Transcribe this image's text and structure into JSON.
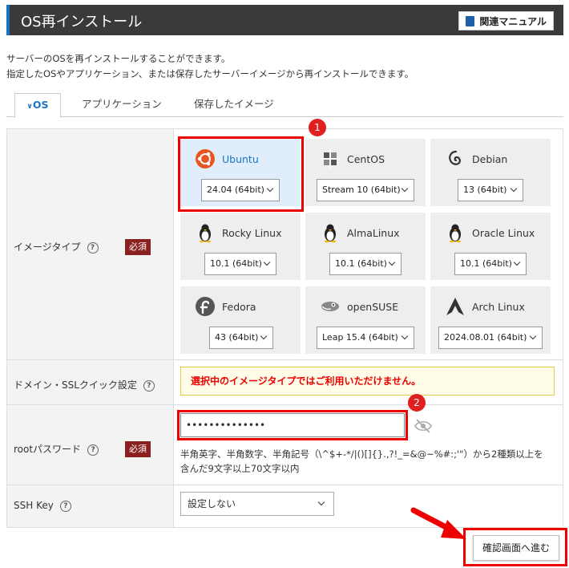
{
  "header": {
    "title": "OS再インストール",
    "manual_label": "関連マニュアル"
  },
  "description": {
    "line1": "サーバーのOSを再インストールすることができます。",
    "line2": "指定したOSやアプリケーション、または保存したサーバーイメージから再インストールできます。"
  },
  "tabs": [
    {
      "label": "OS",
      "active": true
    },
    {
      "label": "アプリケーション",
      "active": false
    },
    {
      "label": "保存したイメージ",
      "active": false
    }
  ],
  "image_type": {
    "label": "イメージタイプ",
    "required": "必須",
    "options": [
      {
        "name": "Ubuntu",
        "version": "24.04 (64bit)",
        "selected": true,
        "icon": "ubuntu-icon"
      },
      {
        "name": "CentOS",
        "version": "Stream 10 (64bit)",
        "selected": false,
        "icon": "centos-icon"
      },
      {
        "name": "Debian",
        "version": "13 (64bit)",
        "selected": false,
        "icon": "debian-icon"
      },
      {
        "name": "Rocky Linux",
        "version": "10.1 (64bit)",
        "selected": false,
        "icon": "penguin-icon"
      },
      {
        "name": "AlmaLinux",
        "version": "10.1 (64bit)",
        "selected": false,
        "icon": "penguin-icon"
      },
      {
        "name": "Oracle Linux",
        "version": "10.1 (64bit)",
        "selected": false,
        "icon": "penguin-icon"
      },
      {
        "name": "Fedora",
        "version": "43 (64bit)",
        "selected": false,
        "icon": "fedora-icon"
      },
      {
        "name": "openSUSE",
        "version": "Leap 15.4 (64bit)",
        "selected": false,
        "icon": "opensuse-icon"
      },
      {
        "name": "Arch Linux",
        "version": "2024.08.01 (64bit)",
        "selected": false,
        "icon": "arch-icon"
      }
    ]
  },
  "domain_ssl": {
    "label": "ドメイン・SSLクイック設定",
    "warning": "選択中のイメージタイプではご利用いただけません。"
  },
  "root_password": {
    "label": "rootパスワード",
    "required": "必須",
    "value": "••••••••••••••",
    "help_line1": "半角英字、半角数字、半角記号（\\^$+-*/|()[]{}.,?!_=&@~%#:;'\"）から2種類以上を",
    "help_line2": "含んだ9文字以上70文字以内"
  },
  "ssh_key": {
    "label": "SSH Key",
    "selected": "設定しない"
  },
  "annotations": {
    "badge1": "1",
    "badge2": "2"
  },
  "confirm_label": "確認画面へ進む",
  "colors": {
    "accent": "#1a73c4",
    "header_bg": "#3a3a3a",
    "required_bg": "#8b2020",
    "highlight": "#e00000"
  }
}
